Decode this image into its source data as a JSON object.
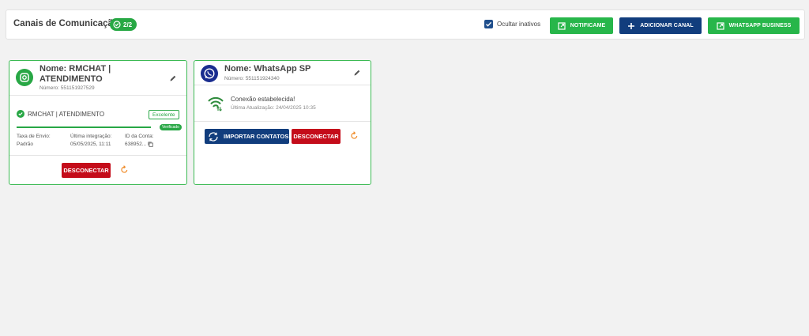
{
  "header": {
    "title": "Canais de Comunicação",
    "badge": "2/2",
    "checkbox_label": "Ocultar inativos",
    "buttons": {
      "notificame": "NOTIFICAME",
      "adicionar": "ADICIONAR CANAL",
      "whatsapp_business": "WHATSAPP BUSINESS"
    }
  },
  "cards": [
    {
      "name": "Nome: RMCHAT |\nATENDIMENTO",
      "number": "Número: 551151927529",
      "status_name": "RMCHAT | ATENDIMENTO",
      "quality_badge": "Excelente",
      "verified_badge": "Verificado",
      "progress": 1.0,
      "info": {
        "col1_label": "Taxa de Envio:",
        "col1_value": "Padrão",
        "col2_label": "Última integração:",
        "col2_value": "05/05/2025, 11:11",
        "col3_label": "ID da Conta:",
        "col3_value": "638952..."
      },
      "disconnect_label": "DESCONECTAR"
    },
    {
      "name": "Nome: WhatsApp SP",
      "number": "Número: 551151924340",
      "connection_status": "Conexão estabelecida!",
      "last_update": "Última Atualização: 24/04/2025 10:35",
      "import_label": "IMPORTAR CONTATOS",
      "disconnect_label": "DESCONECTAR"
    }
  ],
  "colors": {
    "green": "#27b64a",
    "blue": "#113d7d",
    "red": "#c40c1a",
    "card_border": "#3cba54"
  }
}
